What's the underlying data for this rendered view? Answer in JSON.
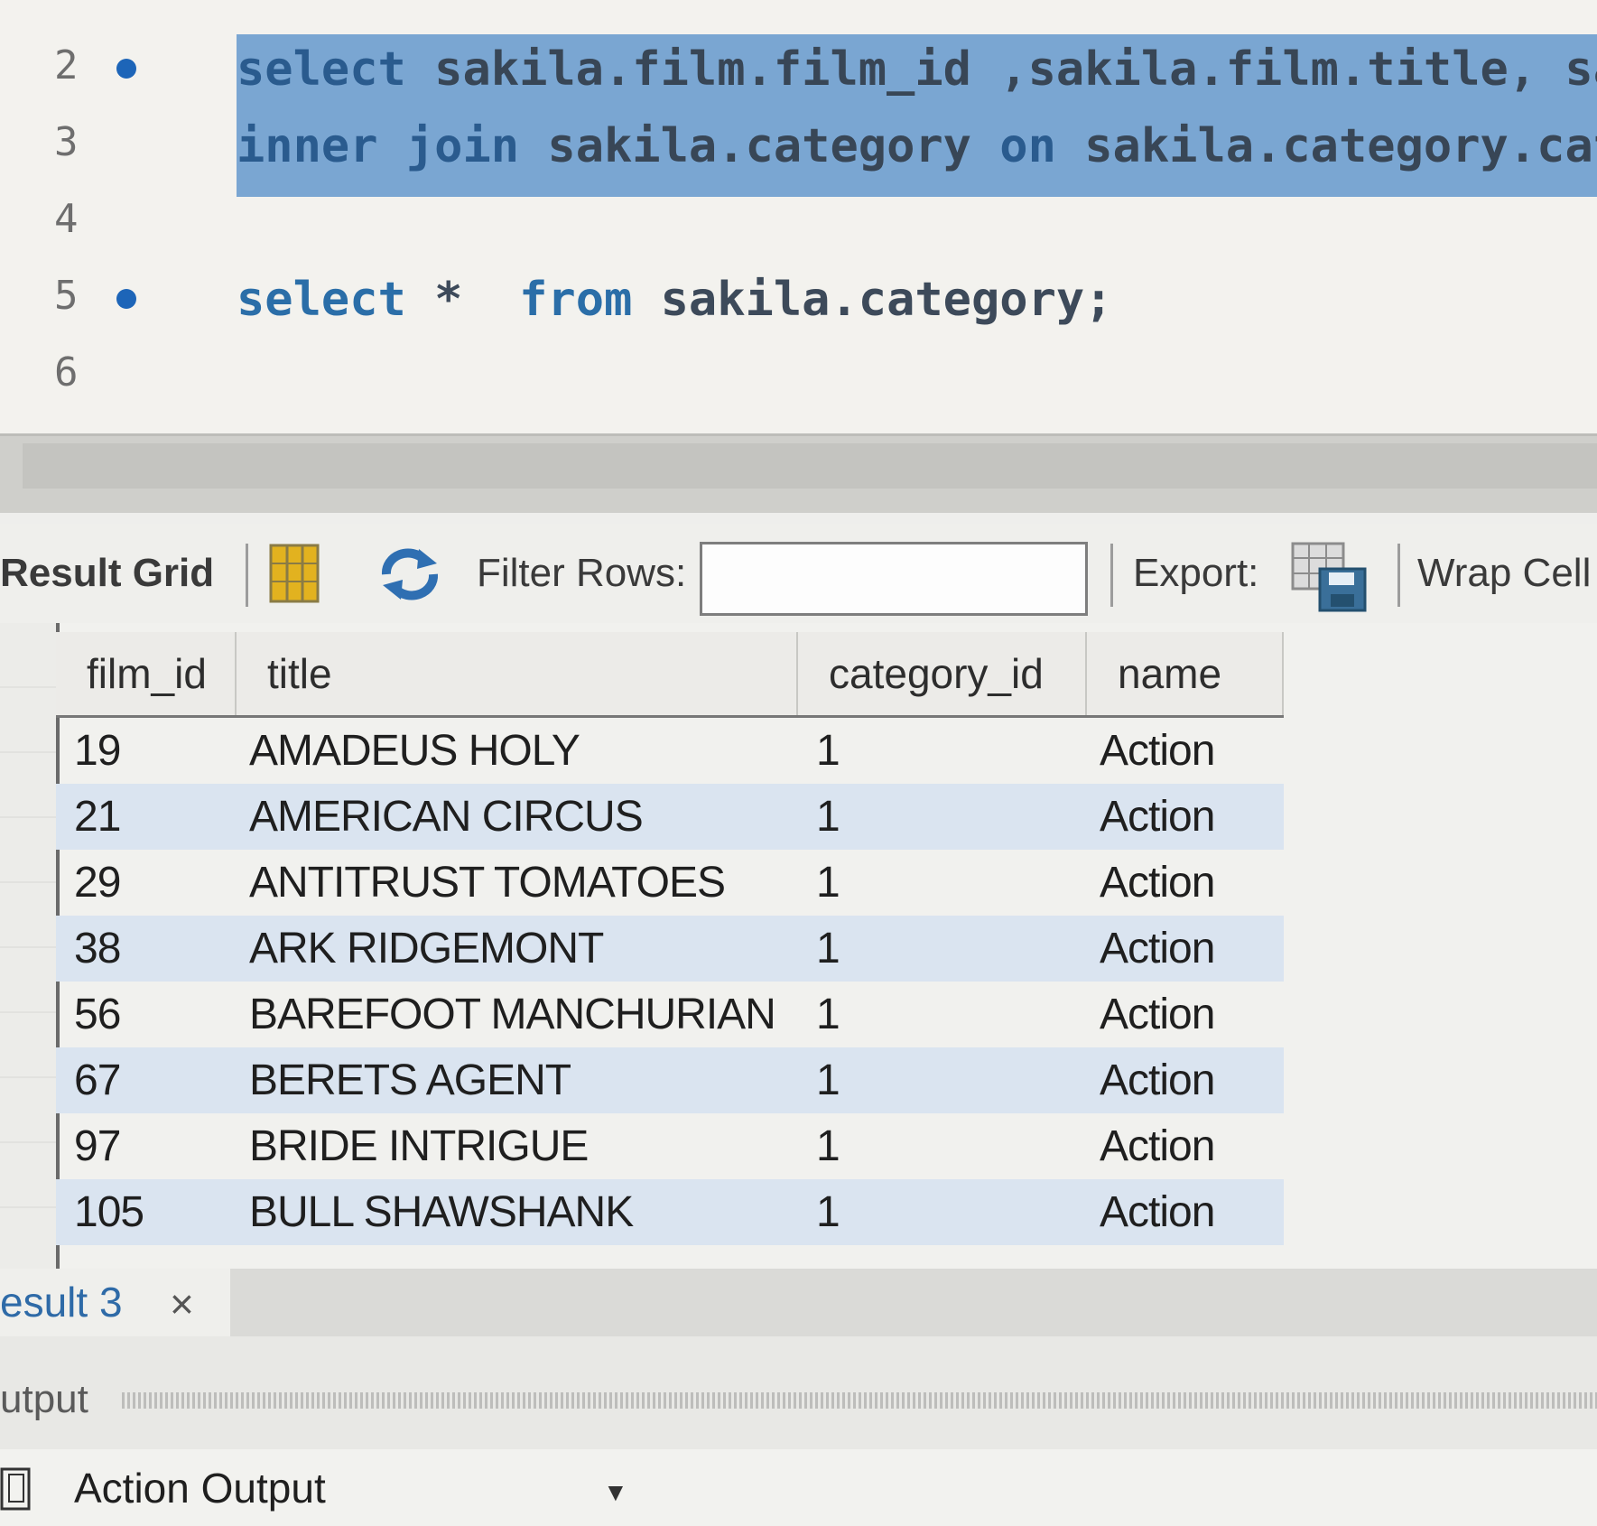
{
  "editor": {
    "lines": [
      {
        "no": "2",
        "dot": true,
        "kw1": "select",
        "rest": " sakila.film.film_id ,sakila.film.title, sa",
        "selected": true
      },
      {
        "no": "3",
        "dot": false,
        "kw1": "inner join",
        "rest": " sakila.category ",
        "kw2": "on",
        "rest2": " sakila.category.cat",
        "selected": true
      },
      {
        "no": "4",
        "dot": false,
        "kw1": "",
        "rest": "",
        "selected": false
      },
      {
        "no": "5",
        "dot": true,
        "kw1": "select",
        "rest": " *  ",
        "kw2": "from",
        "rest2": " sakila.category;",
        "selected": false
      },
      {
        "no": "6",
        "dot": false,
        "kw1": "",
        "rest": "",
        "selected": false
      }
    ]
  },
  "toolbar": {
    "result_grid_label": "Result Grid",
    "filter_rows_label": "Filter Rows:",
    "filter_value": "",
    "export_label": "Export:",
    "wrap_cell_label": "Wrap Cell"
  },
  "grid": {
    "columns": [
      "film_id",
      "title",
      "category_id",
      "name"
    ],
    "rows": [
      [
        "19",
        "AMADEUS HOLY",
        "1",
        "Action"
      ],
      [
        "21",
        "AMERICAN CIRCUS",
        "1",
        "Action"
      ],
      [
        "29",
        "ANTITRUST TOMATOES",
        "1",
        "Action"
      ],
      [
        "38",
        "ARK RIDGEMONT",
        "1",
        "Action"
      ],
      [
        "56",
        "BAREFOOT MANCHURIAN",
        "1",
        "Action"
      ],
      [
        "67",
        "BERETS AGENT",
        "1",
        "Action"
      ],
      [
        "97",
        "BRIDE INTRIGUE",
        "1",
        "Action"
      ],
      [
        "105",
        "BULL SHAWSHANK",
        "1",
        "Action"
      ]
    ]
  },
  "result_tab": {
    "label": "esult 3",
    "close": "×"
  },
  "output": {
    "label": "utput",
    "action_output_label": "Action Output",
    "caret": "▼"
  },
  "colors": {
    "selection": "#7aa6d2",
    "keyword": "#2b6ea8",
    "alt_row": "#dae4f0",
    "tab_text": "#2e6aa7"
  }
}
